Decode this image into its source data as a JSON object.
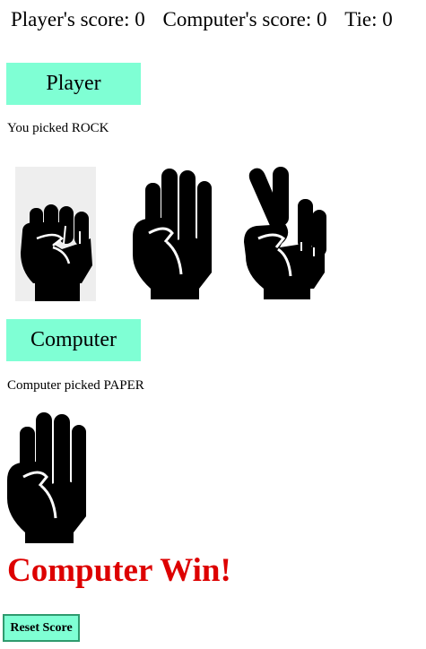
{
  "scoreboard": {
    "player_score": "Player's score: 0",
    "computer_score": "Computer's score: 0",
    "tie_score": "Tie: 0"
  },
  "player": {
    "label": "Player",
    "picked_text": "You picked ROCK",
    "choices": [
      {
        "name": "rock",
        "icon": "rock-hand-icon"
      },
      {
        "name": "paper",
        "icon": "paper-hand-icon"
      },
      {
        "name": "scissors",
        "icon": "scissors-hand-icon"
      }
    ]
  },
  "computer": {
    "label": "Computer",
    "picked_text": "Computer picked PAPER",
    "choice_icon": "paper-hand-icon"
  },
  "result": {
    "text": "Computer Win!"
  },
  "reset_button": {
    "label": "Reset Score"
  },
  "colors": {
    "label_bg": "#7fffd4",
    "result_text": "#dd0000",
    "hand": "#000000"
  }
}
